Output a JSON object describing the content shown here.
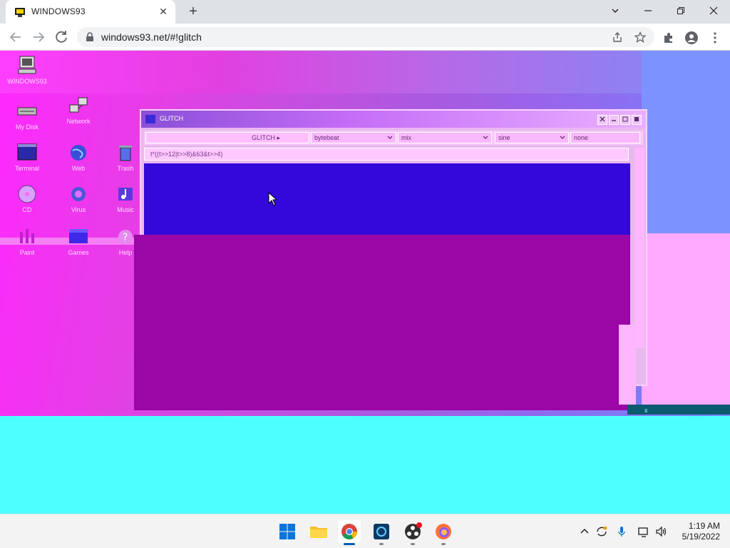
{
  "browser": {
    "tab_title": "WINDOWS93",
    "url": "windows93.net/#!glitch",
    "new_tab": "+",
    "close_tab": "✕"
  },
  "desktop": {
    "icons": [
      {
        "label": "WINDOWS93",
        "icon": "computer-icon"
      },
      {
        "label": "My Disk",
        "icon": "disk-icon"
      },
      {
        "label": "Network",
        "icon": "network-icon"
      },
      {
        "label": "Terminal",
        "icon": "terminal-icon"
      },
      {
        "label": "Web",
        "icon": "globe-icon"
      },
      {
        "label": "Trash",
        "icon": "trash-icon"
      },
      {
        "label": "CD",
        "icon": "cd-icon"
      },
      {
        "label": "Virus",
        "icon": "virus-icon"
      },
      {
        "label": "Music",
        "icon": "music-icon"
      },
      {
        "label": "Paint",
        "icon": "paint-icon"
      },
      {
        "label": "Games",
        "icon": "games-icon"
      },
      {
        "label": "Help",
        "icon": "help-icon"
      }
    ]
  },
  "app_window": {
    "title": "GLITCH",
    "button_label": "GLITCH ▸",
    "selects": [
      "bytebeat",
      "mix",
      "sine",
      "none"
    ],
    "input_value": "t*((t>>12|t>>8)&63&t>>4)"
  },
  "taskbar": {
    "apps": [
      {
        "name": "Start",
        "icon": "windows-logo-icon"
      },
      {
        "name": "File Explorer",
        "icon": "folder-icon"
      },
      {
        "name": "Google Chrome",
        "icon": "chrome-icon"
      },
      {
        "name": "Photo Editor",
        "icon": "photo-editor-icon"
      },
      {
        "name": "OBS Studio",
        "icon": "obs-icon"
      },
      {
        "name": "Firefox",
        "icon": "firefox-icon"
      }
    ],
    "time": "1:19 AM",
    "date": "5/19/2022"
  },
  "colors": {
    "desktop_magenta": "#ff28ff",
    "canvas_blue": "#3308d9",
    "glitch_purple": "#9b06a6",
    "glitch_cyan": "#4effff",
    "accent": "#005fb8"
  }
}
